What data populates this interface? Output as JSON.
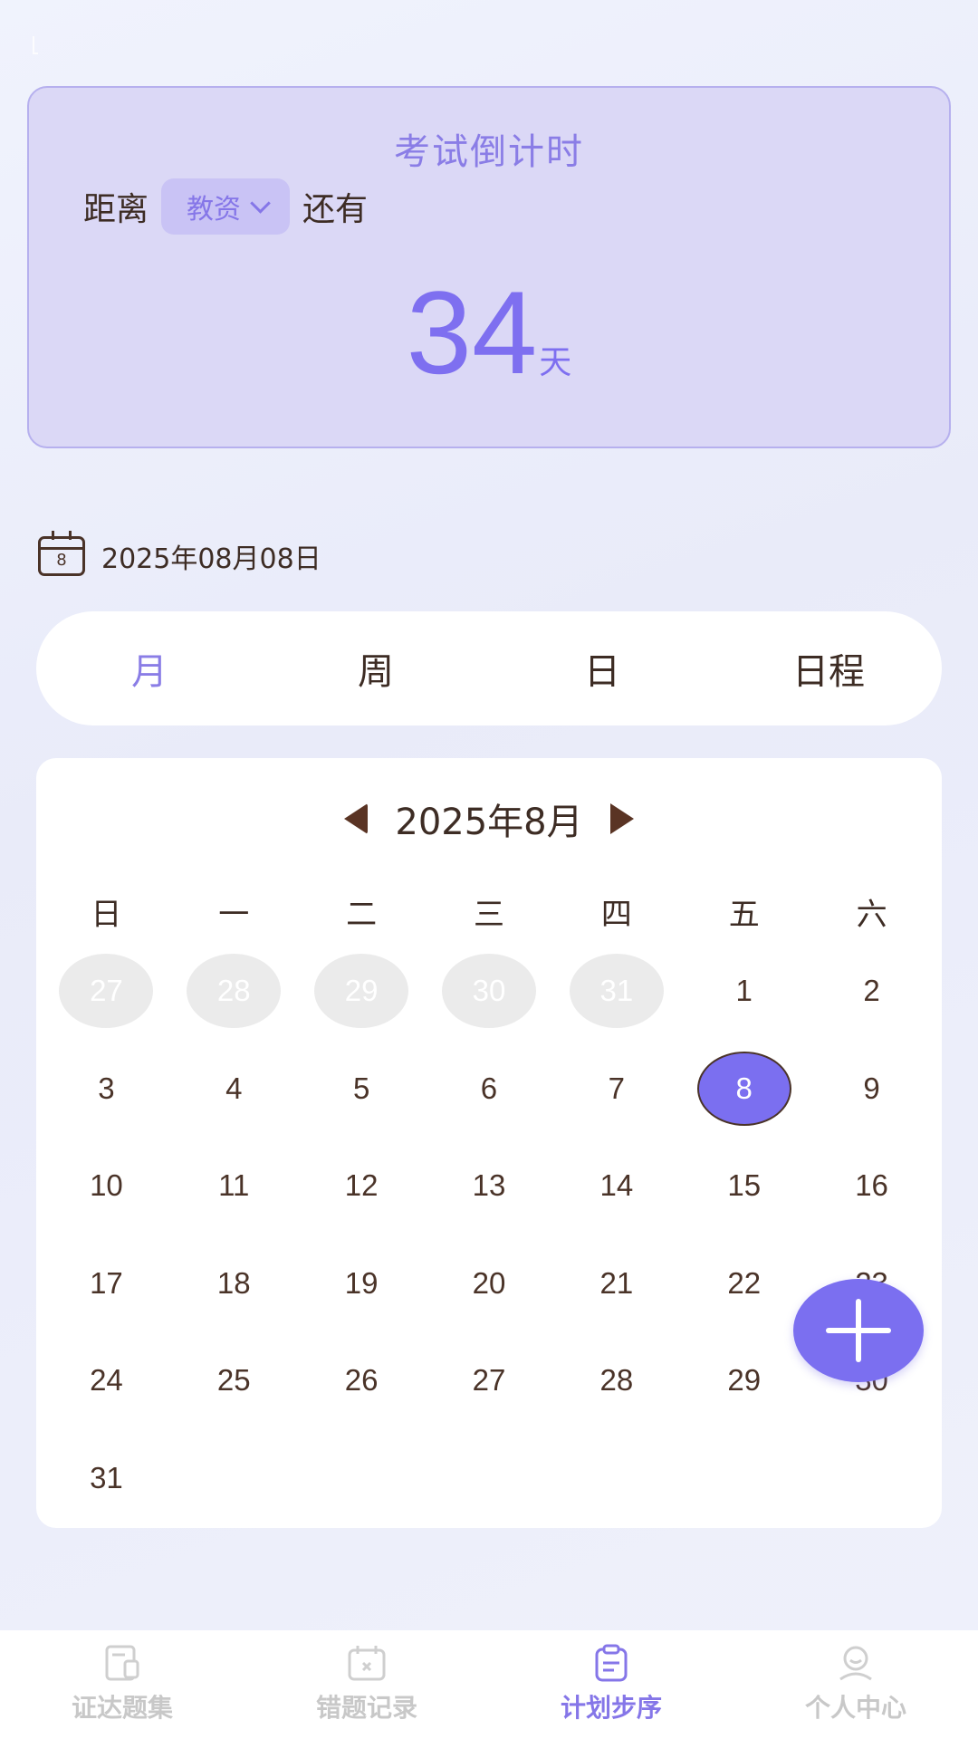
{
  "countdown": {
    "title": "考试倒计时",
    "prefix": "距离",
    "exam": "教资",
    "suffix": "还有",
    "days": "34",
    "unit": "天"
  },
  "date": {
    "icon_day": "8",
    "text": "2025年08月08日"
  },
  "tabs": [
    {
      "label": "月",
      "active": true
    },
    {
      "label": "周",
      "active": false
    },
    {
      "label": "日",
      "active": false
    },
    {
      "label": "日程",
      "active": false
    }
  ],
  "calendar": {
    "month_label": "2025年8月",
    "weekdays": [
      "日",
      "一",
      "二",
      "三",
      "四",
      "五",
      "六"
    ],
    "selected": "8",
    "days": [
      {
        "d": "27",
        "other": true
      },
      {
        "d": "28",
        "other": true
      },
      {
        "d": "29",
        "other": true
      },
      {
        "d": "30",
        "other": true
      },
      {
        "d": "31",
        "other": true
      },
      {
        "d": "1"
      },
      {
        "d": "2"
      },
      {
        "d": "3"
      },
      {
        "d": "4"
      },
      {
        "d": "5"
      },
      {
        "d": "6"
      },
      {
        "d": "7"
      },
      {
        "d": "8"
      },
      {
        "d": "9"
      },
      {
        "d": "10"
      },
      {
        "d": "11"
      },
      {
        "d": "12"
      },
      {
        "d": "13"
      },
      {
        "d": "14"
      },
      {
        "d": "15"
      },
      {
        "d": "16"
      },
      {
        "d": "17"
      },
      {
        "d": "18"
      },
      {
        "d": "19"
      },
      {
        "d": "20"
      },
      {
        "d": "21"
      },
      {
        "d": "22"
      },
      {
        "d": "23"
      },
      {
        "d": "24"
      },
      {
        "d": "25"
      },
      {
        "d": "26"
      },
      {
        "d": "27"
      },
      {
        "d": "28"
      },
      {
        "d": "29"
      },
      {
        "d": "30"
      },
      {
        "d": "31"
      }
    ]
  },
  "bottom_nav": [
    {
      "label": "证达题集",
      "icon": "question-book-icon",
      "active": false
    },
    {
      "label": "错题记录",
      "icon": "calendar-x-icon",
      "active": false
    },
    {
      "label": "计划步序",
      "icon": "clipboard-icon",
      "active": true
    },
    {
      "label": "个人中心",
      "icon": "user-icon",
      "active": false
    }
  ],
  "colors": {
    "accent": "#7b6ff0",
    "text": "#3d2c24",
    "card": "#dbd8f6"
  }
}
